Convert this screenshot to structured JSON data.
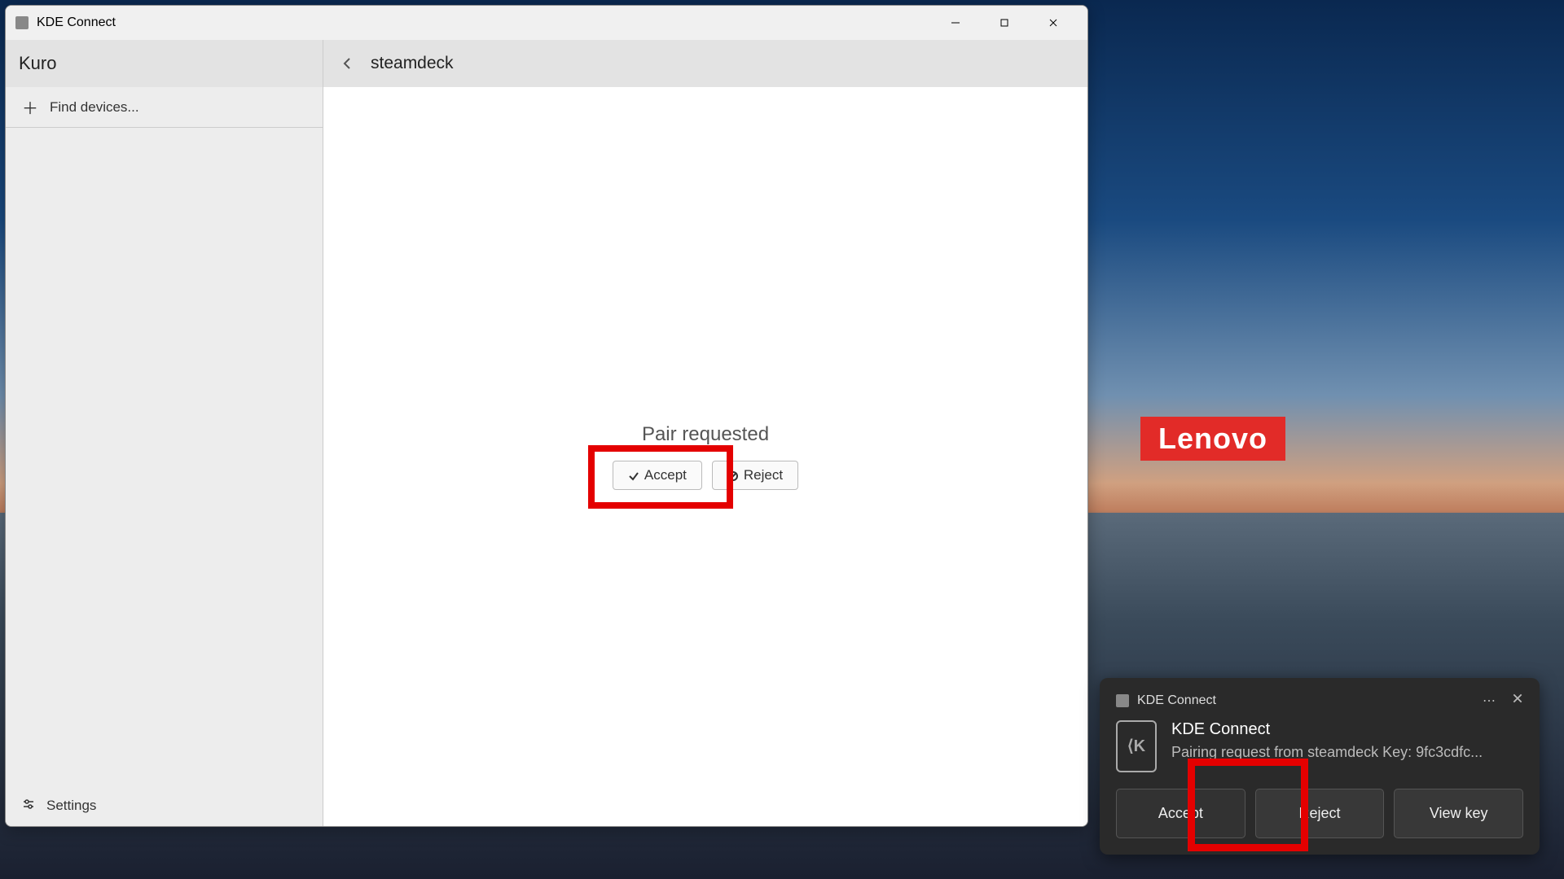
{
  "window": {
    "title": "KDE Connect"
  },
  "sidebar": {
    "host_name": "Kuro",
    "find_devices_label": "Find devices...",
    "settings_label": "Settings"
  },
  "content": {
    "device_name": "steamdeck",
    "pair_title": "Pair requested",
    "accept_label": "Accept",
    "reject_label": "Reject"
  },
  "brand": {
    "logo_text": "Lenovo"
  },
  "notification": {
    "app_name": "KDE Connect",
    "title": "KDE Connect",
    "message": "Pairing request from steamdeck Key: 9fc3cdfc...",
    "icon_letter": "⟨K",
    "buttons": {
      "accept": "Accept",
      "reject": "Reject",
      "view_key": "View key"
    }
  }
}
